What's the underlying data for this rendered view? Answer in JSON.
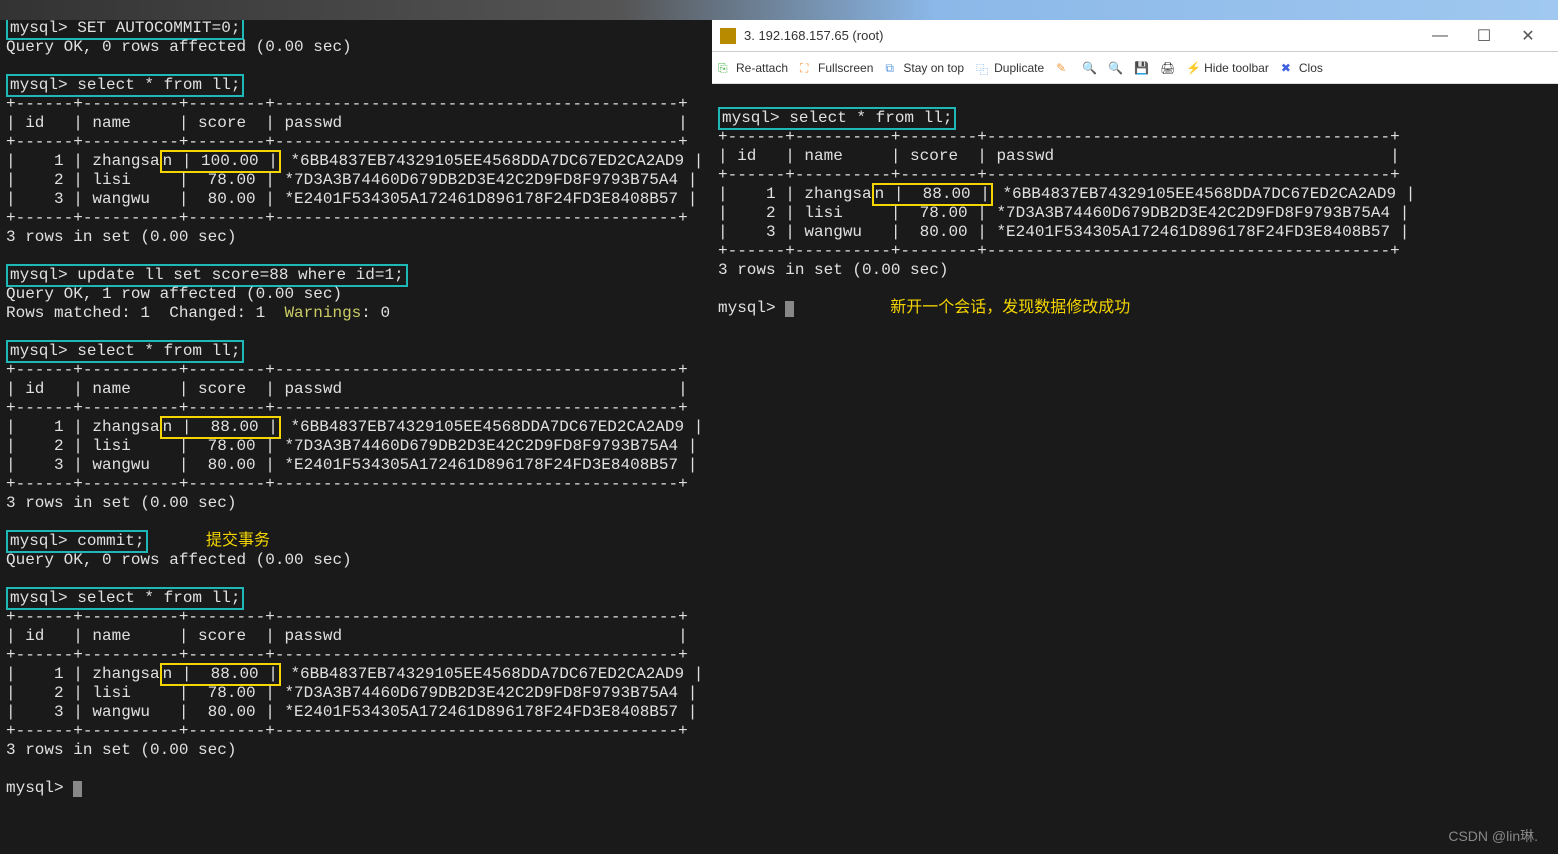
{
  "left": {
    "cmd_autocommit": "mysql> SET AUTOCOMMIT=0;",
    "resp_autocommit": "Query OK, 0 rows affected (0.00 sec)",
    "cmd_select1": "mysql> select * from ll;",
    "table_border": "+------+----------+--------+------------------------------------------+",
    "table_border2": "+------+----------+--------+------------------------------------------+",
    "table_header": "| id   | name     | score  | passwd                                   |",
    "t1_row1_pre": "|    1 | zhangsa",
    "t1_row1_box": "n | 100.00 |",
    "t1_row1_post": " *6BB4837EB74329105EE4568DDA7DC67ED2CA2AD9 |",
    "t1_row2": "|    2 | lisi     |  78.00 | *7D3A3B74460D679DB2D3E42C2D9FD8F9793B75A4 |",
    "t1_row3": "|    3 | wangwu   |  80.00 | *E2401F534305A172461D896178F24FD3E8408B57 |",
    "rows_in_set": "3 rows in set (0.00 sec)",
    "cmd_update": "mysql> update ll set score=88 where id=1;",
    "resp_update1": "Query OK, 1 row affected (0.00 sec)",
    "resp_update2_a": "Rows matched: 1  Changed: 1  ",
    "resp_update2_b": "Warnings",
    "resp_update2_c": ": 0",
    "cmd_select2": "mysql> select * from ll;",
    "t2_row1_pre": "|    1 | zhangsa",
    "t2_row1_box": "n |  88.00 |",
    "t2_row1_post": " *6BB4837EB74329105EE4568DDA7DC67ED2CA2AD9 |",
    "cmd_commit": "mysql> commit;",
    "annot_commit": "提交事务",
    "resp_commit": "Query OK, 0 rows affected (0.00 sec)",
    "cmd_select3": "mysql> select * from ll;",
    "t3_row1_pre": "|    1 | zhangsa",
    "t3_row1_box": "n |  88.00 |",
    "t3_row1_post": " *6BB4837EB74329105EE4568DDA7DC67ED2CA2AD9 |",
    "prompt_final": "mysql> "
  },
  "right": {
    "window_title": "3. 192.168.157.65 (root)",
    "toolbar": {
      "reattach": "Re-attach",
      "fullscreen": "Fullscreen",
      "stayontop": "Stay on top",
      "duplicate": "Duplicate",
      "hide_toolbar": "Hide toolbar",
      "close": "Clos"
    },
    "cmd_select": "mysql> select * from ll;",
    "table_border": "+------+----------+--------+------------------------------------------+",
    "table_header": "| id   | name     | score  | passwd                                   |",
    "r_row1_pre": "|    1 | zhangsa",
    "r_row1_box": "n |  88.00 |",
    "r_row1_post": " *6BB4837EB74329105EE4568DDA7DC67ED2CA2AD9 |",
    "r_row2": "|    2 | lisi     |  78.00 | *7D3A3B74460D679DB2D3E42C2D9FD8F9793B75A4 |",
    "r_row3": "|    3 | wangwu   |  80.00 | *E2401F534305A172461D896178F24FD3E8408B57 |",
    "rows_in_set": "3 rows in set (0.00 sec)",
    "prompt_final": "mysql> ",
    "annotation": "新开一个会话，发现数据修改成功"
  },
  "watermark": "CSDN @lin琳."
}
